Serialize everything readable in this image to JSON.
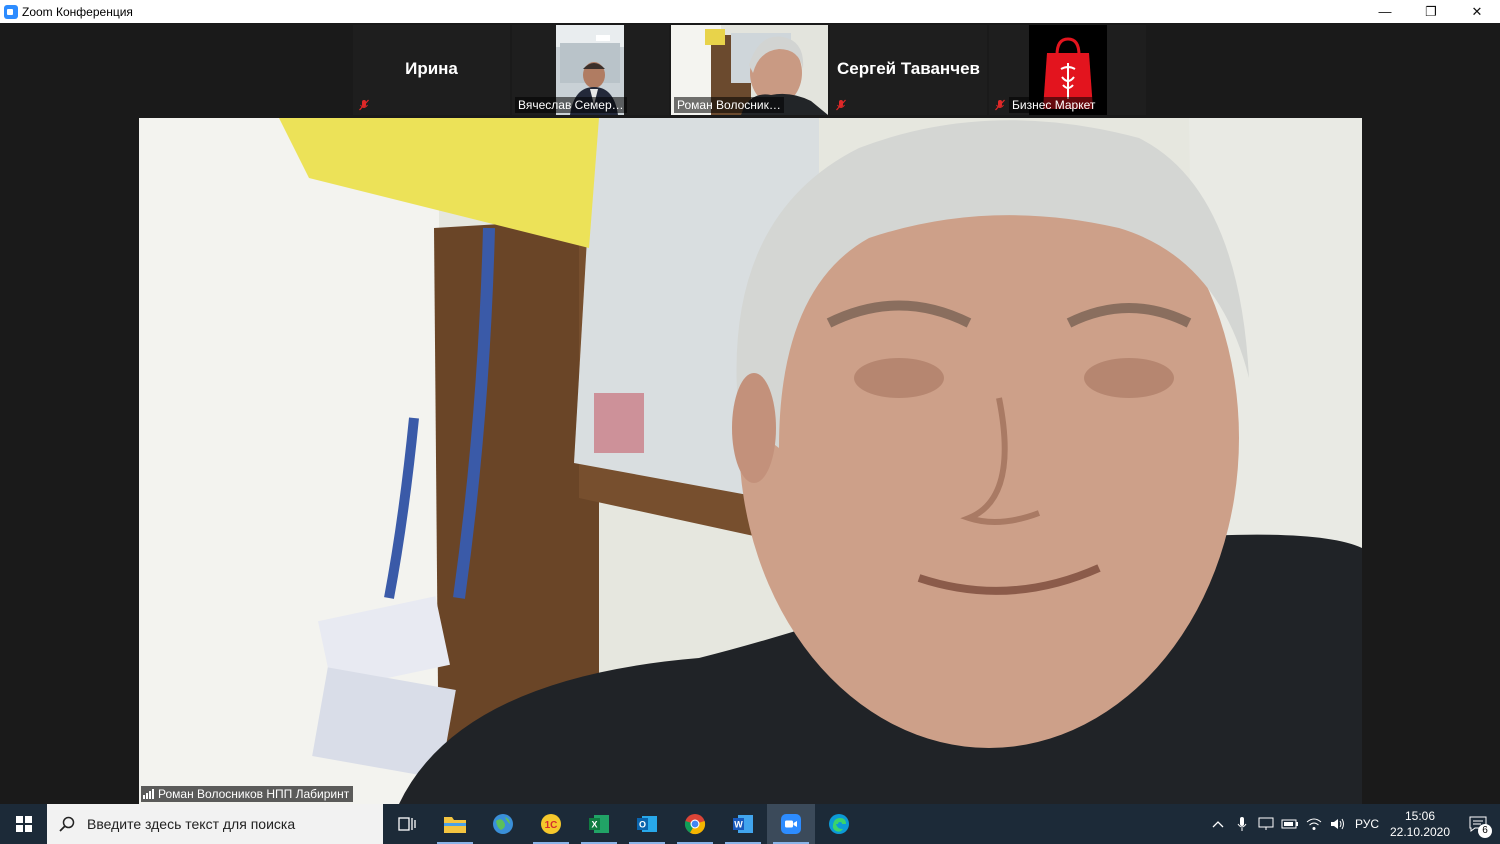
{
  "window": {
    "title": "Zoom Конференция",
    "controls": {
      "minimize": "—",
      "restore": "❐",
      "close": "✕"
    }
  },
  "participants": [
    {
      "name": "Ирина",
      "label": "",
      "video": false,
      "muted": true,
      "active": false
    },
    {
      "name": "",
      "label": "Вячеслав Семер…",
      "video": true,
      "muted": false,
      "active": false
    },
    {
      "name": "",
      "label": "Роман Волосник…",
      "video": true,
      "muted": false,
      "active": true
    },
    {
      "name": "Сергей Таванчев",
      "label": "",
      "video": false,
      "muted": true,
      "active": false
    },
    {
      "name": "",
      "label": "Бизнес Маркет",
      "video": true,
      "muted": true,
      "active": false
    }
  ],
  "speaker": {
    "label": "Роман Волосников НПП Лабиринт"
  },
  "taskbar": {
    "search_placeholder": "Введите здесь текст для поиска",
    "apps": [
      "task-view",
      "file-explorer",
      "globe-app",
      "1c-app",
      "excel",
      "outlook",
      "chrome",
      "word",
      "zoom",
      "edge"
    ],
    "language": "РУС",
    "time": "15:06",
    "date": "22.10.2020",
    "notifications": "6"
  },
  "colors": {
    "active_outline": "#9ad25a",
    "mute_red": "#e02828",
    "taskbar_bg": "#1c2a38"
  }
}
